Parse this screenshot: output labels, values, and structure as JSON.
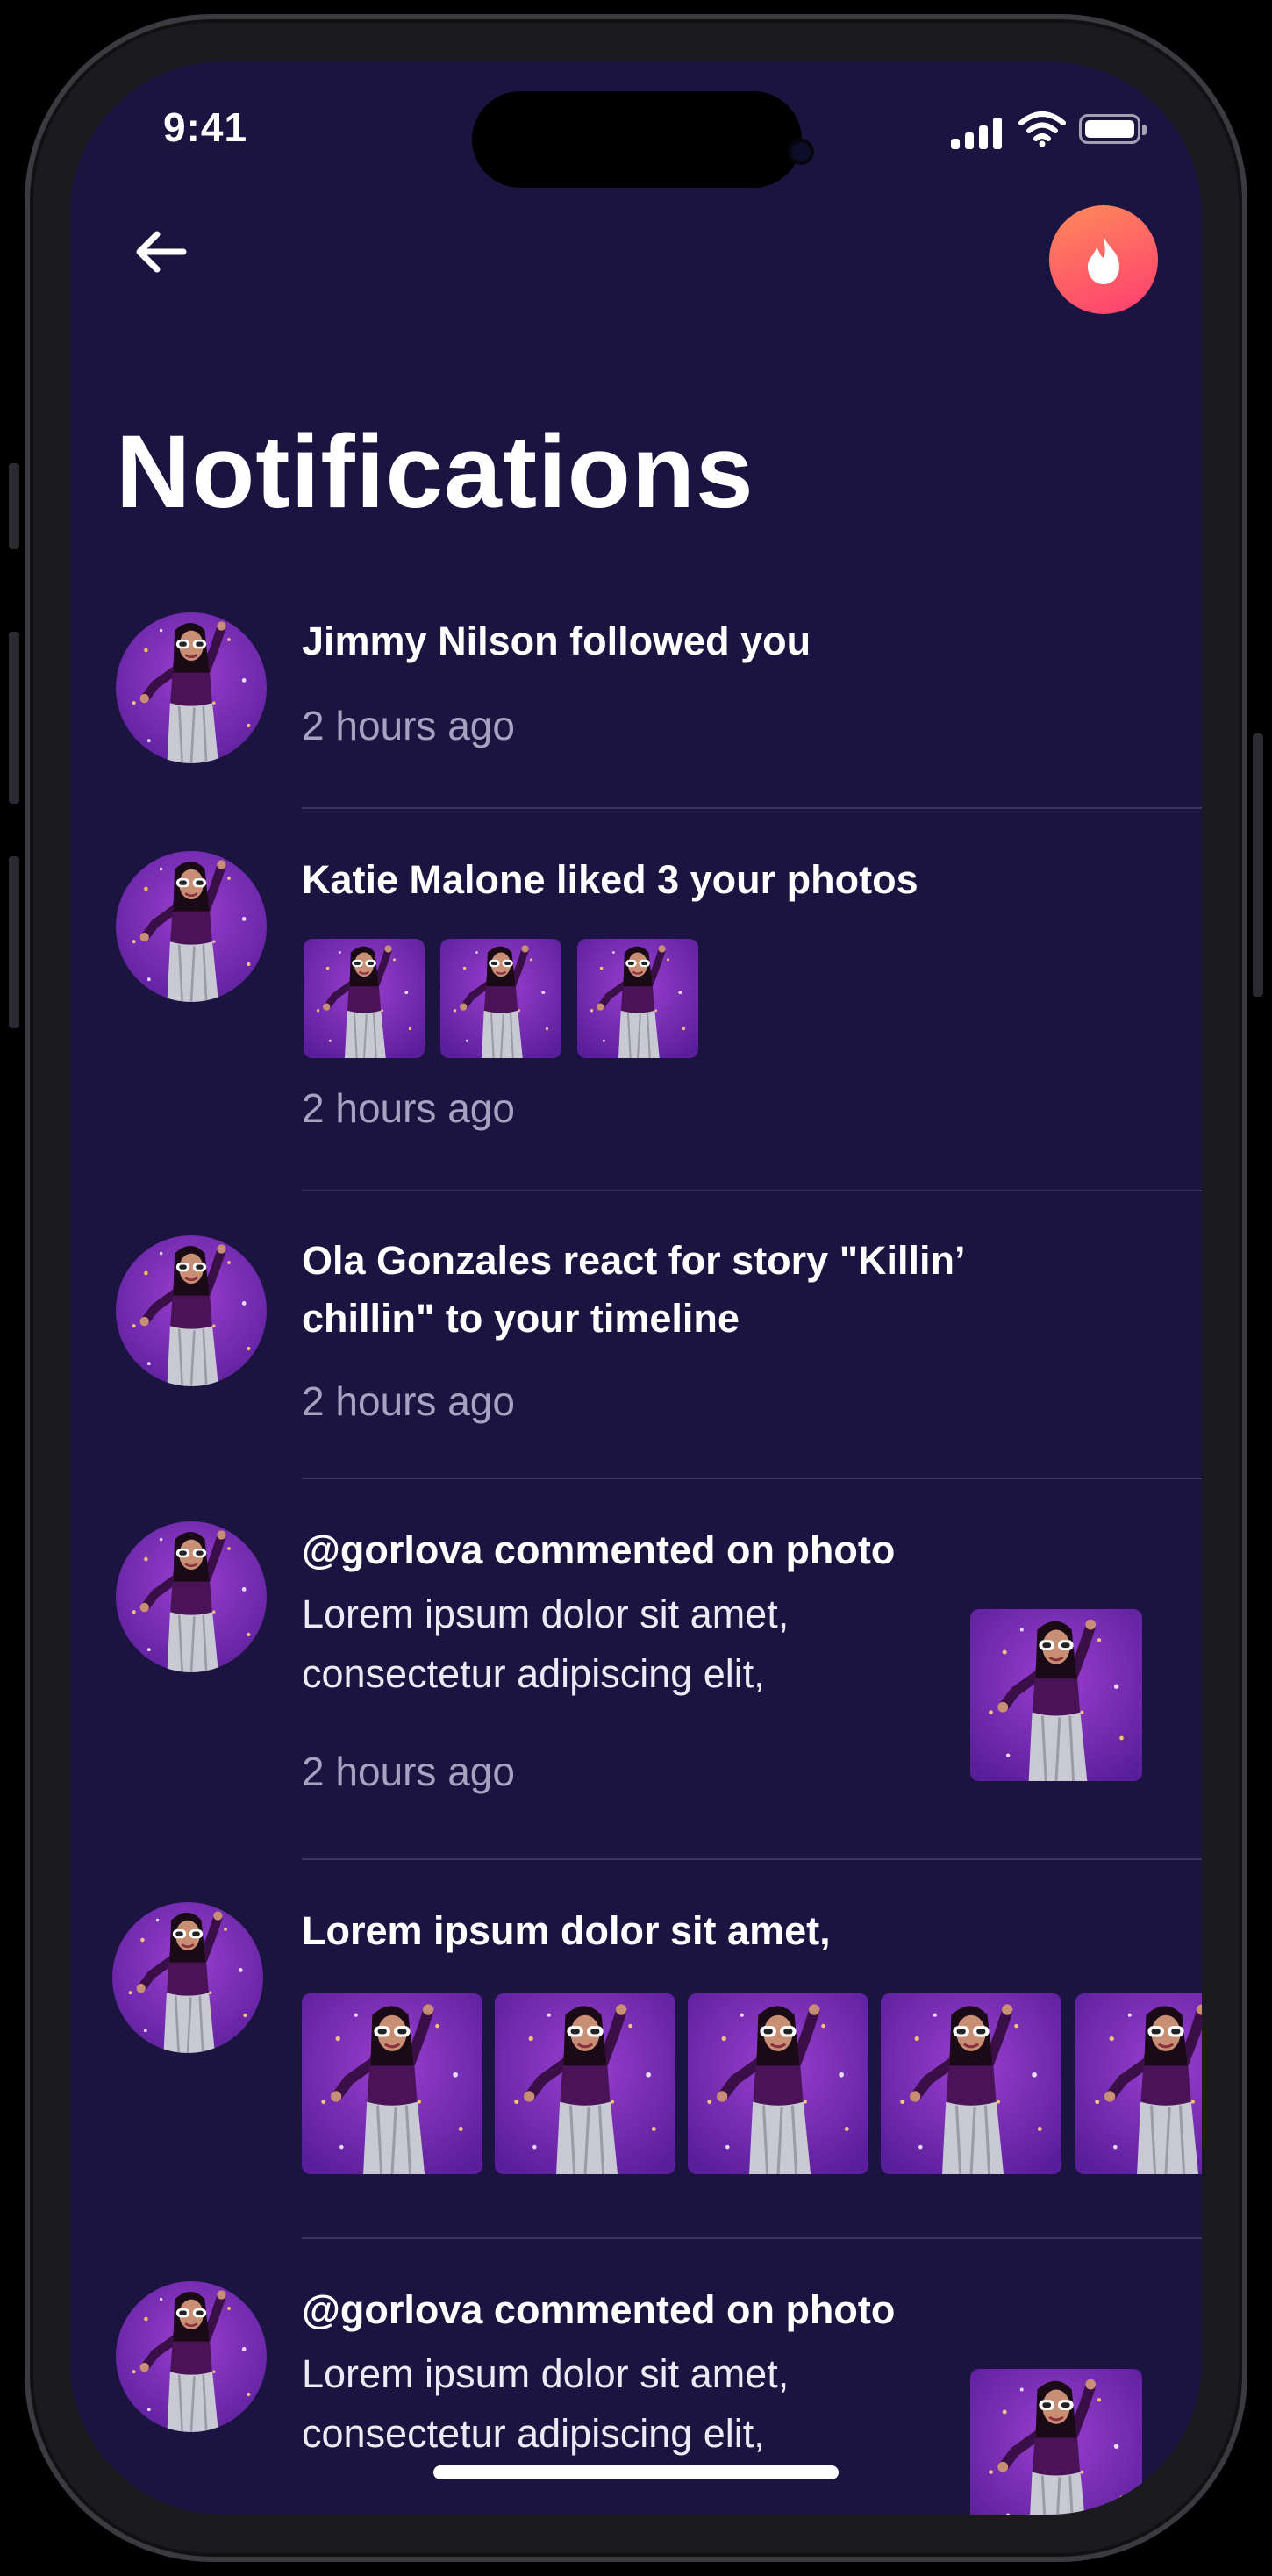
{
  "status_bar": {
    "time": "9:41"
  },
  "header": {
    "title": "Notifications"
  },
  "colors": {
    "background": "#1b1440",
    "accent_start": "#ff8a5a",
    "accent_end": "#ff3d71",
    "muted_text": "#a8a2c0"
  },
  "icons": {
    "back": "arrow-left-icon",
    "fire": "fire-icon"
  },
  "notifications": [
    {
      "title": "Jimmy Nilson followed you",
      "time": "2 hours ago"
    },
    {
      "title": "Katie Malone liked 3 your photos",
      "time": "2 hours ago",
      "photo_count": 3
    },
    {
      "title": "Ola Gonzales react for story \"Killin’ chillin\" to your timeline",
      "time": "2 hours ago"
    },
    {
      "title": "@gorlova commented on photo",
      "body": " Lorem ipsum dolor sit amet, consectetur adipiscing elit,",
      "time": "2 hours ago"
    },
    {
      "title": " Lorem ipsum dolor sit amet,",
      "photo_count": 5
    },
    {
      "title": "@gorlova commented on photo",
      "body": " Lorem ipsum dolor sit amet, consectetur adipiscing elit,"
    }
  ]
}
